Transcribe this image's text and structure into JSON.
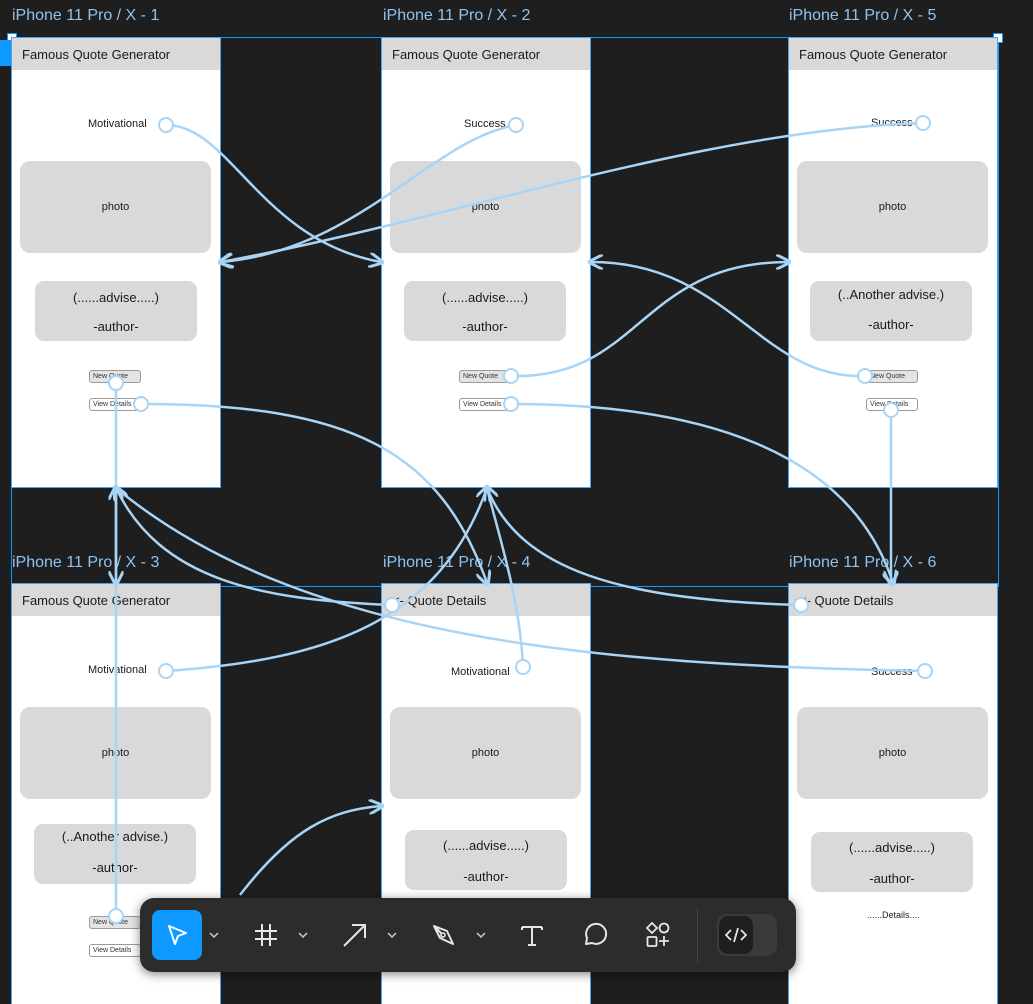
{
  "frames": [
    {
      "label": "iPhone 11 Pro / X - 1",
      "header": "Famous Quote Generator",
      "category": "Motivational",
      "photo": "photo",
      "quote": "(......advise.....)",
      "author": "-author-",
      "new_quote": "New Quote",
      "view_details": "View Details"
    },
    {
      "label": "iPhone 11 Pro / X - 2",
      "header": "Famous Quote Generator",
      "category": "Success",
      "photo": "photo",
      "quote": "(......advise.....)",
      "author": "-author-",
      "new_quote": "New Quote",
      "view_details": "View Details"
    },
    {
      "label": "iPhone 11 Pro / X - 5",
      "header": "Famous Quote Generator",
      "category": "Success",
      "photo": "photo",
      "quote": "(..Another advise.)",
      "author": "-author-",
      "new_quote": "New Quote",
      "view_details": "View Details"
    },
    {
      "label": "iPhone 11 Pro / X - 3",
      "header": "Famous Quote Generator",
      "category": "Motivational",
      "photo": "photo",
      "quote": "(..Another advise.)",
      "author": "-author-",
      "new_quote": "New Quote",
      "view_details": "View Details"
    },
    {
      "label": "iPhone 11 Pro / X - 4",
      "header": "<-  Quote Details",
      "category": "Motivational",
      "photo": "photo",
      "quote": "(......advise.....)",
      "author": "-author-"
    },
    {
      "label": "iPhone 11 Pro / X - 6",
      "header": "<-  Quote Details",
      "category": "Success",
      "photo": "photo",
      "quote": "(......advise.....)",
      "author": "-author-",
      "details": "......Details...."
    }
  ],
  "toolbar": {
    "tools": [
      {
        "name": "move-tool",
        "icon": "cursor-arrow-icon",
        "active": true
      },
      {
        "name": "frame-tool",
        "icon": "hash-frame-icon",
        "active": false
      },
      {
        "name": "arrow-tool",
        "icon": "arrow-icon",
        "active": false
      },
      {
        "name": "pen-tool",
        "icon": "pen-icon",
        "active": false
      },
      {
        "name": "text-tool",
        "icon": "text-icon",
        "active": false
      },
      {
        "name": "comment-tool",
        "icon": "comment-bubble-icon",
        "active": false
      },
      {
        "name": "resources-tool",
        "icon": "components-icon",
        "active": false
      }
    ],
    "dev_mode_icon": "code-brackets-icon"
  },
  "colors": {
    "canvas": "#1e1e1e",
    "wire": "#a8d4f5",
    "selection": "#0d99ff",
    "frame_label": "#8fc3ef",
    "placeholder_gray": "#d9d9d9",
    "toolbar": "#2c2c2c"
  }
}
